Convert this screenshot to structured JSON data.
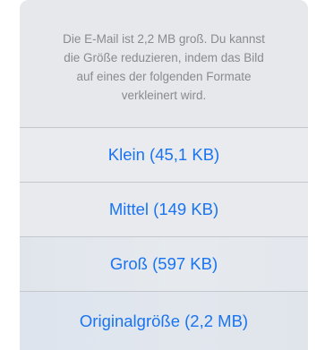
{
  "alert": {
    "message_lines": [
      "Die E-Mail ist 2,2 MB groß. Du kannst",
      "die Größe reduzieren, indem das Bild",
      "auf eines der folgenden Formate",
      "verkleinert wird."
    ],
    "options": [
      {
        "label": "Klein (45,1 KB)"
      },
      {
        "label": "Mittel (149 KB)"
      },
      {
        "label": "Groß (597 KB)"
      },
      {
        "label": "Originalgröße (2,2 MB)"
      }
    ]
  },
  "colors": {
    "accent": "#1a74f0",
    "message_text": "#8a8a8f",
    "sheet_background": "#e9ebee",
    "separator": "#c4c7cc"
  }
}
